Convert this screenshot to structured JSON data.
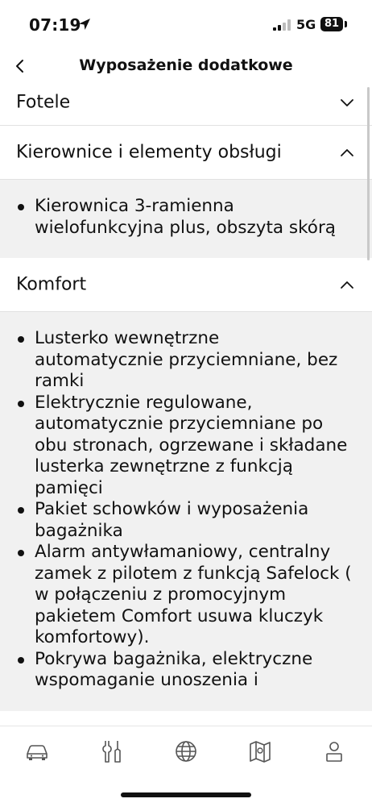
{
  "status_bar": {
    "time": "07:19",
    "network": "5G",
    "battery": "81"
  },
  "nav": {
    "title": "Wyposażenie dodatkowe"
  },
  "sections": [
    {
      "label": "Fotele",
      "expanded": false,
      "items": []
    },
    {
      "label": "Kierownice i elementy obsługi",
      "expanded": true,
      "items": [
        "Kierownica 3-ramienna wielofunkcyjna plus, obszyta skórą"
      ]
    },
    {
      "label": "Komfort",
      "expanded": true,
      "items": [
        "Lusterko wewnętrzne automatycznie przyciemniane, bez ramki",
        "Elektrycznie regulowane, automatycznie przyciemniane po obu stronach, ogrzewane i składane lusterka zewnętrzne z funkcją pamięci",
        "Pakiet schowków i wyposażenia bagażnika",
        "Alarm antywłamaniowy, centralny zamek z pilotem z funkcją Safelock ( w połączeniu z promocyjnym pakietem Comfort usuwa kluczyk komfortowy).",
        "Pokrywa bagażnika, elektryczne wspomaganie unoszenia i"
      ]
    }
  ],
  "tab_bar": {
    "tabs": [
      {
        "icon": "car-icon"
      },
      {
        "icon": "tools-icon"
      },
      {
        "icon": "globe-icon"
      },
      {
        "icon": "map-icon"
      },
      {
        "icon": "profile-icon"
      }
    ]
  },
  "colors": {
    "background": "#ffffff",
    "section_body": "#f1f1f1",
    "text": "#111111",
    "divider": "#e1e1e1"
  }
}
